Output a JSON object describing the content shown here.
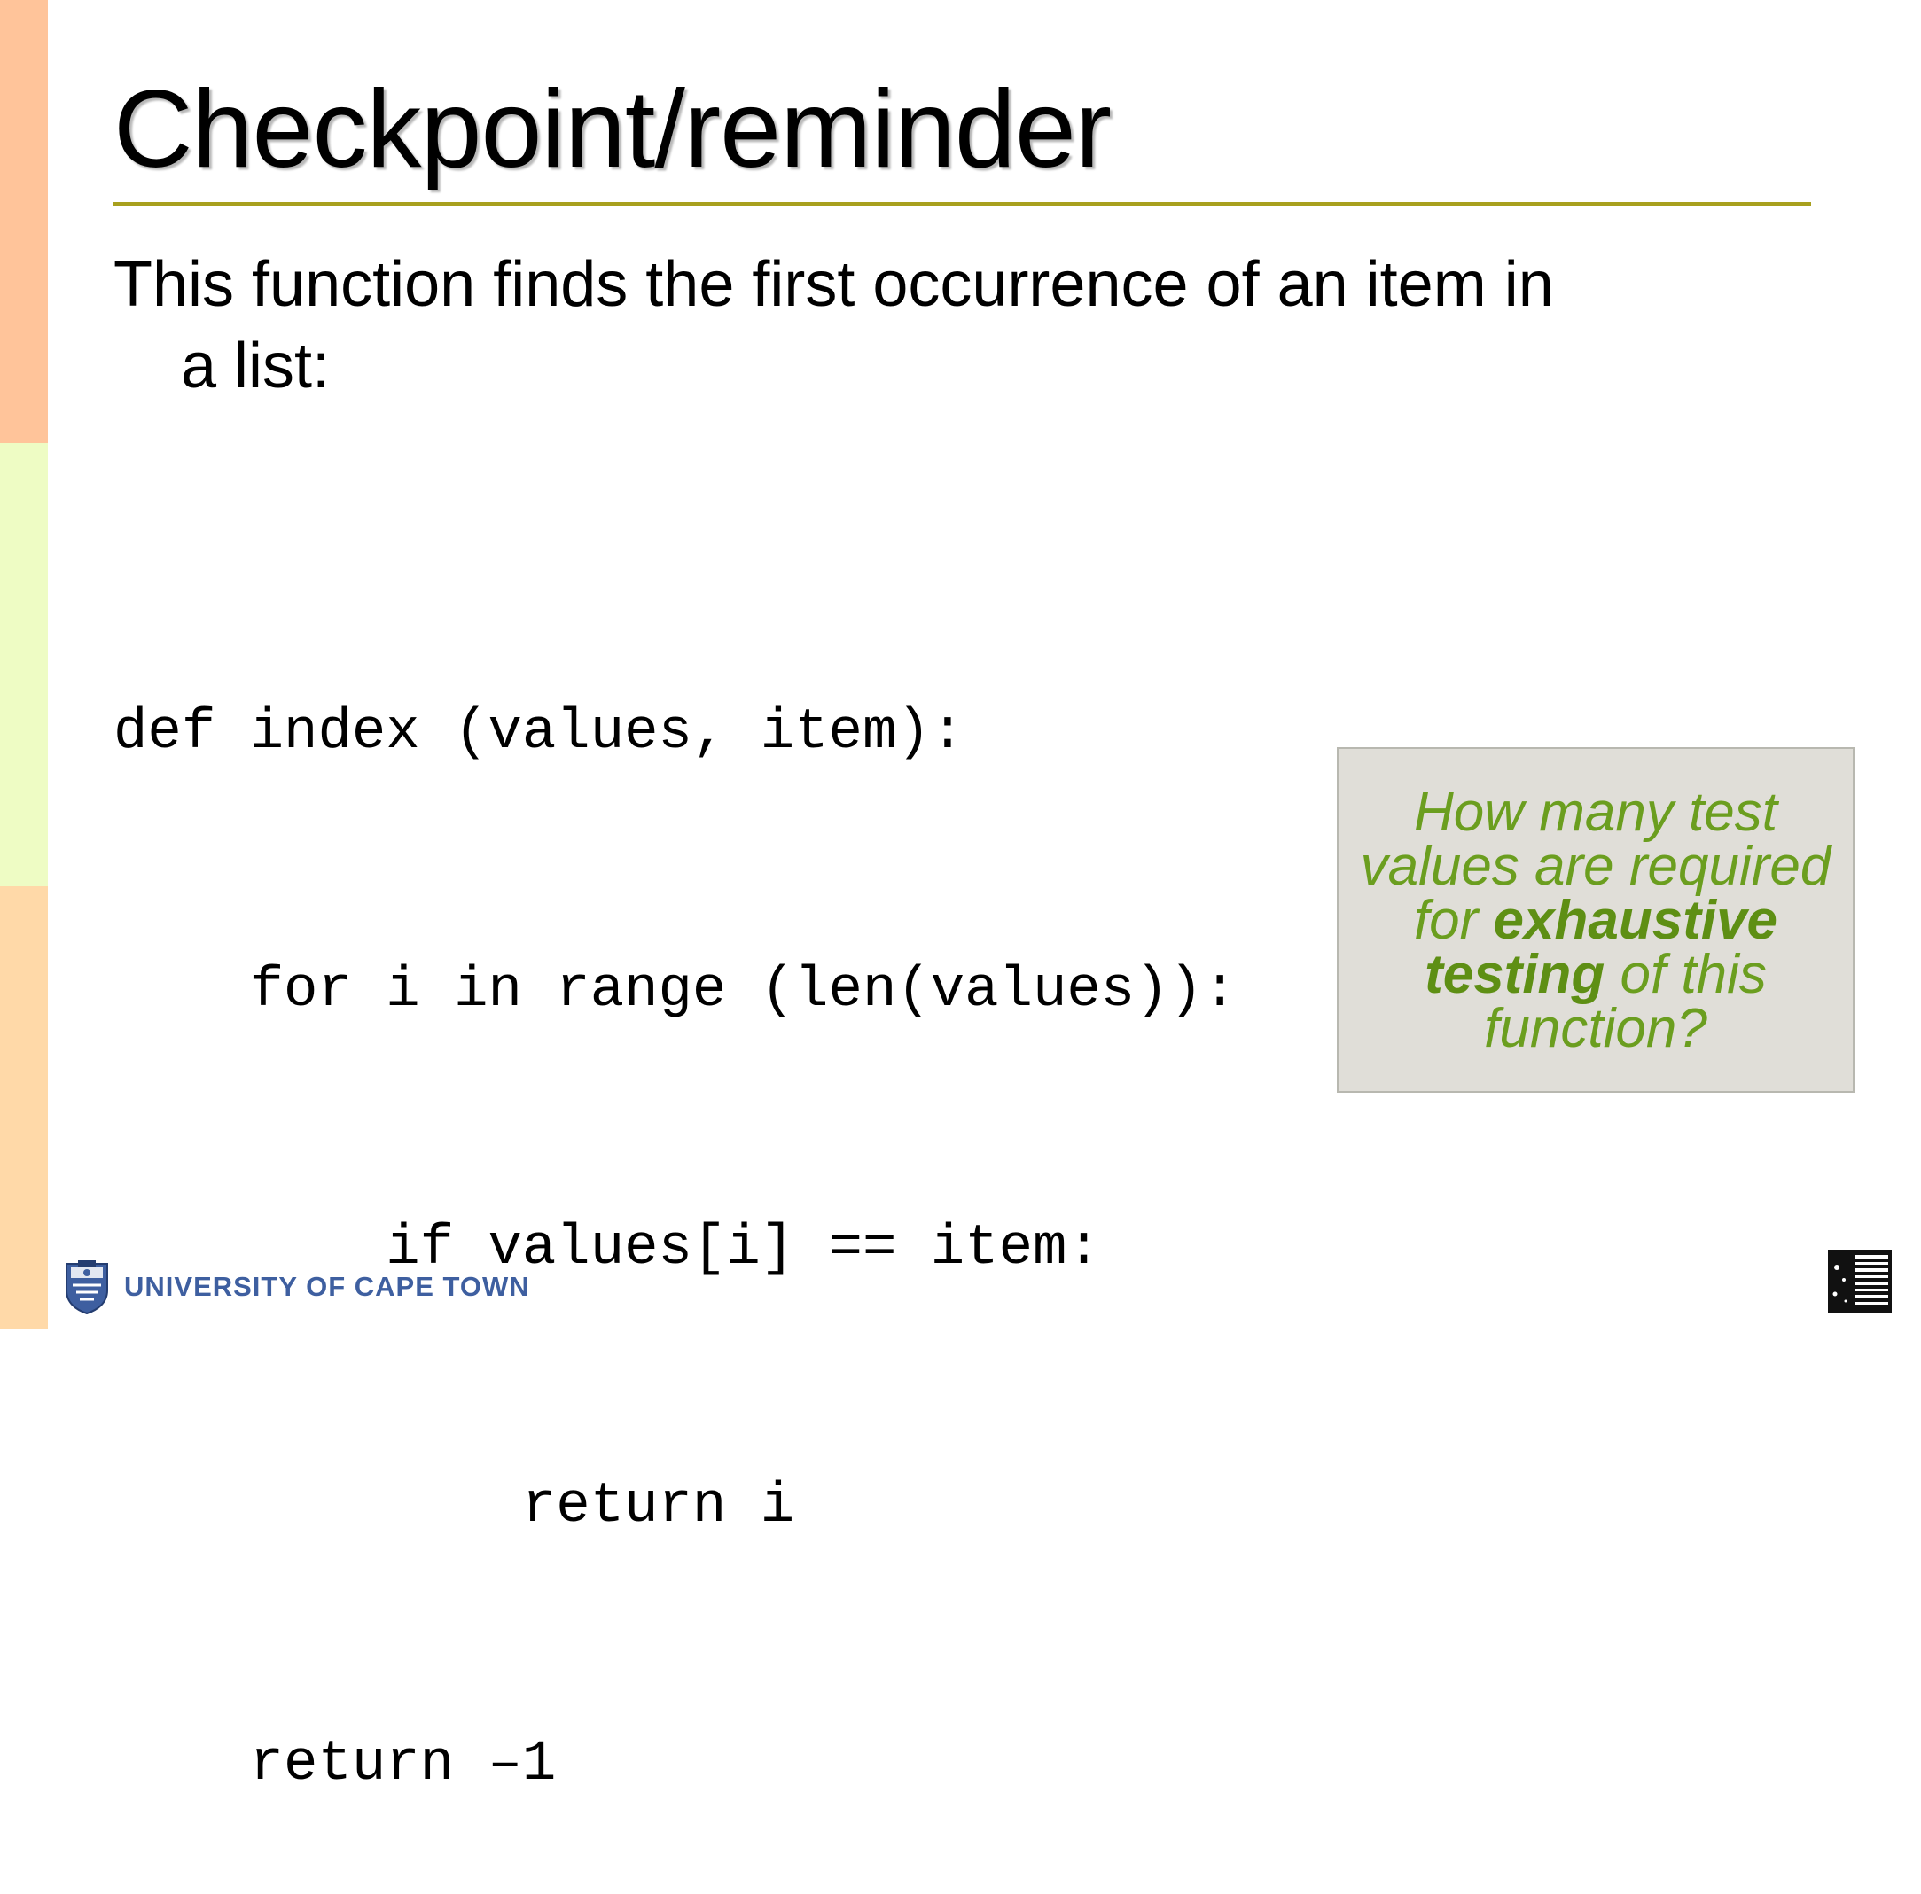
{
  "slide": {
    "title": "Checkpoint/reminder",
    "intro": "This function finds the first occurrence of an item in a list:",
    "code_lines": [
      "def index (values, item):",
      "    for i in range (len(values)):",
      "        if values[i] == item:",
      "            return i",
      "    return –1"
    ]
  },
  "callout": {
    "part1": "How many test values are required for ",
    "bold1": "exhaustive testing",
    "part2": " of this function?"
  },
  "footer": {
    "institution": "UNIVERSITY OF CAPE TOWN"
  },
  "icons": {
    "crest": "uct-crest-icon",
    "corner": "slide-corner-logo-icon"
  },
  "colors": {
    "strip_top": "#FFC49A",
    "strip_mid": "#EEFCC4",
    "strip_bot": "#FFD9A8",
    "title_rule": "#A8A01E",
    "callout_bg": "#E0DED8",
    "callout_text": "#6B9E1F",
    "callout_bold": "#5E8F14",
    "uct_blue": "#3E5FA0"
  }
}
